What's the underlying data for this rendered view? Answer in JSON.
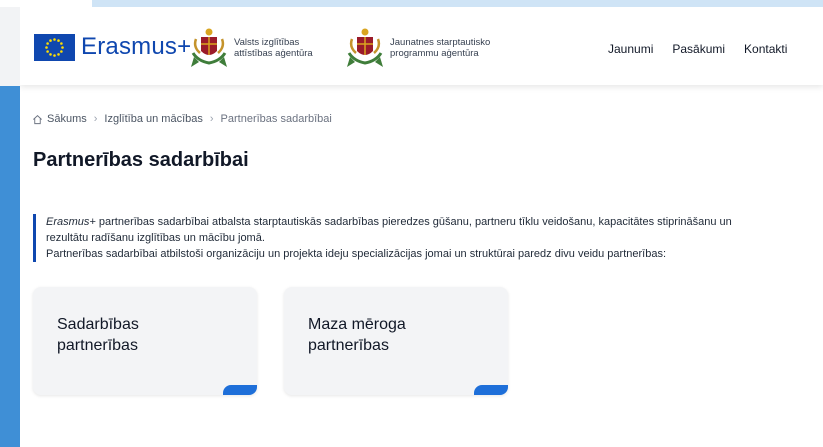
{
  "header": {
    "brand": "Erasmus+",
    "agency1": [
      "Valsts izglītības",
      "attīstības aģentūra"
    ],
    "agency2": [
      "Jaunatnes starptautisko",
      "programmu aģentūra"
    ],
    "nav": [
      {
        "label": "Jaunumi"
      },
      {
        "label": "Pasākumi"
      },
      {
        "label": "Kontakti"
      }
    ]
  },
  "breadcrumb": {
    "home": "Sākums",
    "level1": "Izglītība un mācības",
    "current": "Partnerības sadarbībai"
  },
  "page_title": "Partnerības sadarbībai",
  "intro": {
    "em": "Erasmus+",
    "line1_rest": " partnerības sadarbībai atbalsta starptautiskās sadarbības pieredzes gūšanu, partneru tīklu veidošanu, kapacitātes stiprināšanu un",
    "line2": "rezultātu radīšanu izglītības un mācību jomā.",
    "line3": "Partnerības sadarbībai atbilstoši organizāciju un projekta ideju specializācijas jomai un struktūrai paredz divu veidu partnerības:"
  },
  "cards": [
    {
      "title": "Sadarbības partnerības"
    },
    {
      "title": "Maza mēroga partnerības"
    }
  ],
  "colors": {
    "brand_blue": "#0f47af",
    "accent_blue": "#1e6fd9",
    "card_bg": "#f3f4f6"
  },
  "icons": {
    "home": "home-icon",
    "flag": "eu-flag-icon",
    "coat": "coat-of-arms-icon"
  }
}
